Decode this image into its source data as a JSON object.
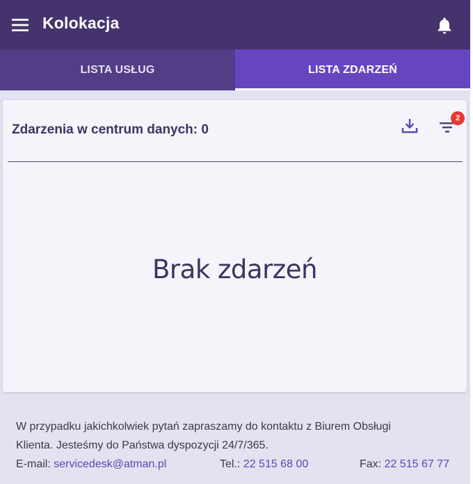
{
  "appbar": {
    "title": "Kolokacja",
    "menu_icon": "menu-icon",
    "bell_icon": "bell-icon",
    "background": "#45336d"
  },
  "tabs": [
    {
      "label": "LISTA USŁUG",
      "active": false
    },
    {
      "label": "LISTA ZDARZEŃ",
      "active": true
    }
  ],
  "card": {
    "title": "Zdarzenia w centrum danych: 0",
    "download_icon": "download-icon",
    "filter_icon": "filter-icon",
    "filter_badge": "2",
    "empty_message": "Brak zdarzeń"
  },
  "footer": {
    "line1": "W przypadku jakichkolwiek pytań zapraszamy do kontaktu z Biurem Obsługi",
    "line2": "Klienta. Jesteśmy do Państwa dyspozycji 24/7/365.",
    "email_label": "E-mail: ",
    "email": "servicedesk@atman.pl",
    "tel_label": "Tel.: ",
    "tel": "22 515 68 00",
    "fax_label": "Fax: ",
    "fax": "22 515 67 77"
  },
  "colors": {
    "accent": "#6646c0",
    "badge": "#e53935",
    "link": "#5c46b0"
  }
}
